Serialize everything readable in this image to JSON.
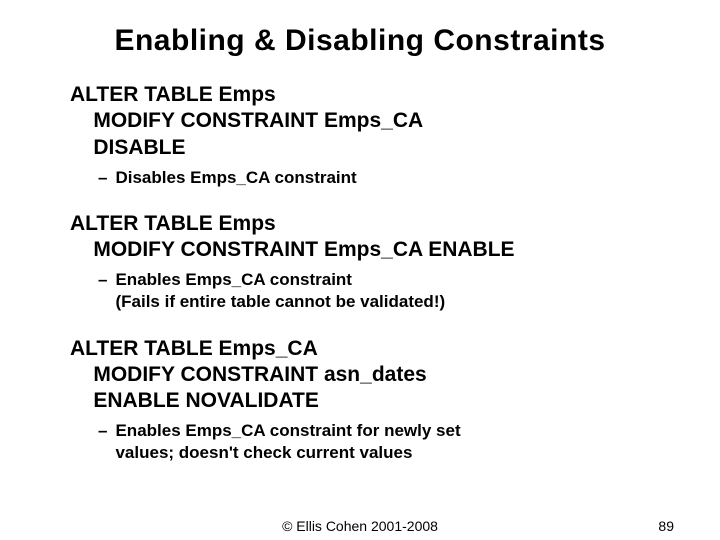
{
  "title": "Enabling & Disabling Constraints",
  "blocks": [
    {
      "code": "ALTER TABLE Emps\n    MODIFY CONSTRAINT Emps_CA\n    DISABLE",
      "note": "Disables Emps_CA constraint"
    },
    {
      "code": "ALTER TABLE Emps\n    MODIFY CONSTRAINT Emps_CA ENABLE",
      "note": "Enables Emps_CA constraint\n(Fails if entire table cannot be validated!)"
    },
    {
      "code": "ALTER TABLE Emps_CA\n    MODIFY CONSTRAINT asn_dates\n    ENABLE NOVALIDATE",
      "note": "Enables Emps_CA constraint for newly set\nvalues; doesn't check current values"
    }
  ],
  "footer": {
    "copyright": "© Ellis Cohen 2001-2008",
    "page": "89"
  }
}
